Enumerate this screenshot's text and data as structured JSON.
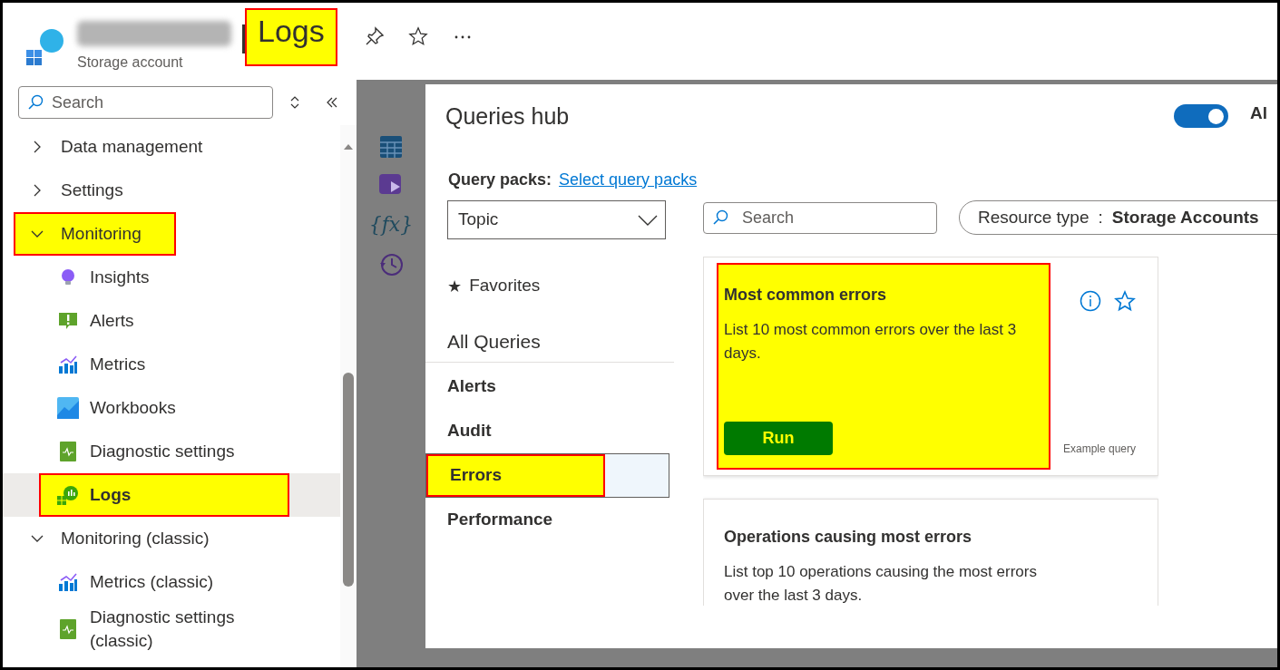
{
  "header": {
    "title": "Logs",
    "title_highlighted": true,
    "subtitle": "Storage account"
  },
  "sidebar": {
    "search": {
      "placeholder": "Search"
    },
    "items": [
      {
        "label": "Data management",
        "expanded": false,
        "highlighted": false
      },
      {
        "label": "Settings",
        "expanded": false,
        "highlighted": false
      },
      {
        "label": "Monitoring",
        "expanded": true,
        "highlighted": true,
        "children": [
          {
            "label": "Insights",
            "selected": false,
            "highlighted": false
          },
          {
            "label": "Alerts",
            "selected": false,
            "highlighted": false
          },
          {
            "label": "Metrics",
            "selected": false,
            "highlighted": false
          },
          {
            "label": "Workbooks",
            "selected": false,
            "highlighted": false
          },
          {
            "label": "Diagnostic settings",
            "selected": false,
            "highlighted": false
          },
          {
            "label": "Logs",
            "selected": true,
            "highlighted": true
          }
        ]
      },
      {
        "label": "Monitoring (classic)",
        "expanded": true,
        "highlighted": false,
        "children": [
          {
            "label": "Metrics (classic)",
            "selected": false,
            "highlighted": false
          },
          {
            "label": "Diagnostic settings (classic)",
            "selected": false,
            "highlighted": false
          }
        ]
      }
    ]
  },
  "rail": {
    "function_label": "{fx}"
  },
  "queries_hub": {
    "title": "Queries hub",
    "toggle": {
      "on": true,
      "label": "Al"
    },
    "query_packs": {
      "label": "Query packs:",
      "link": "Select query packs"
    },
    "topic_dropdown": {
      "value": "Topic"
    },
    "categories": [
      {
        "label": "Favorites",
        "star": "★",
        "kind": "favorites",
        "selected": false,
        "highlighted": false
      },
      {
        "label": "All Queries",
        "kind": "all",
        "selected": false,
        "highlighted": false
      },
      {
        "label": "Alerts",
        "kind": "topic",
        "selected": false,
        "highlighted": false
      },
      {
        "label": "Audit",
        "kind": "topic",
        "selected": false,
        "highlighted": false
      },
      {
        "label": "Errors",
        "kind": "topic",
        "selected": true,
        "highlighted": true
      },
      {
        "label": "Performance",
        "kind": "topic",
        "selected": false,
        "highlighted": false
      }
    ],
    "search": {
      "placeholder": "Search"
    },
    "resource_filter": {
      "label": "Resource type",
      "separator": ":",
      "value": "Storage Accounts"
    },
    "cards": [
      {
        "title": "Most common errors",
        "description": "List 10 most common errors over the last 3 days.",
        "button": "Run",
        "footer": "Example query",
        "highlighted": true
      },
      {
        "title": "Operations causing most errors",
        "description": "List top 10 operations causing the most errors over the last 3 days.",
        "highlighted": false
      }
    ]
  }
}
